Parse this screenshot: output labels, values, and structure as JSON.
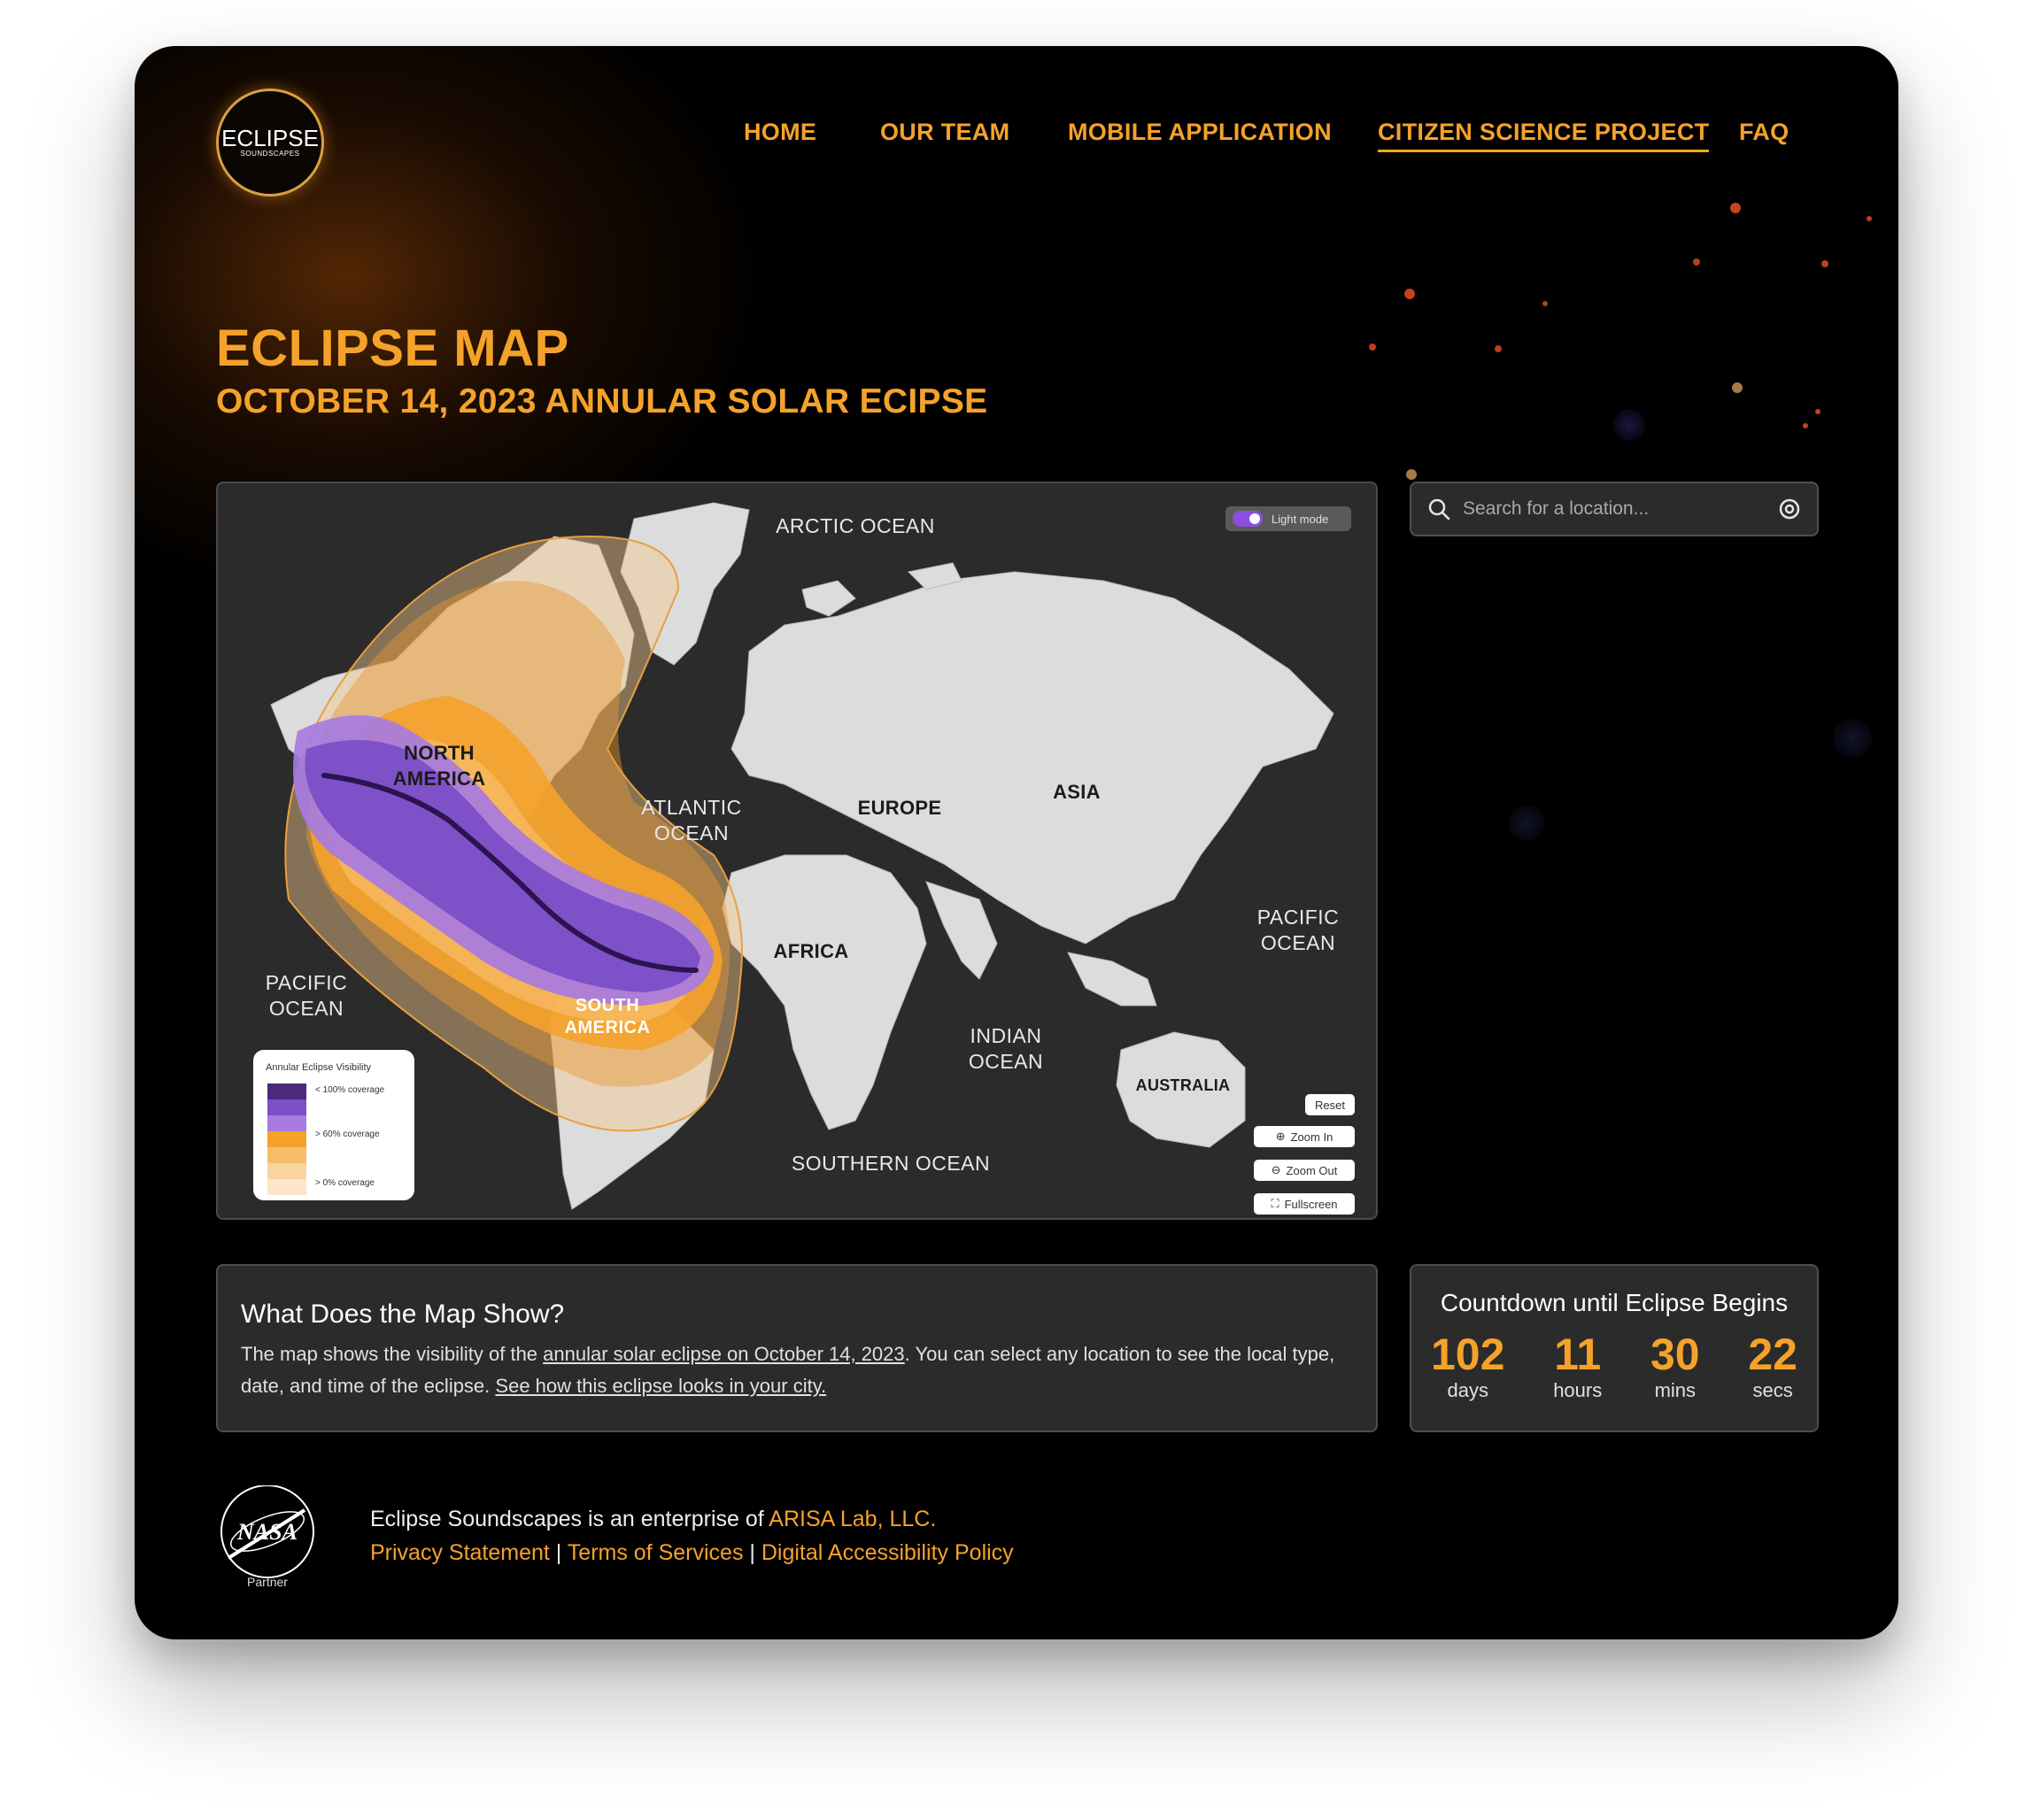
{
  "brand": {
    "logo_line1": "ECLIPSE",
    "logo_line2": "SOUNDSCAPES"
  },
  "nav": [
    {
      "label": "HOME",
      "active": false
    },
    {
      "label": "OUR TEAM",
      "active": false
    },
    {
      "label": "MOBILE APPLICATION",
      "active": false
    },
    {
      "label": "CITIZEN SCIENCE PROJECT",
      "active": true
    },
    {
      "label": "FAQ",
      "active": false
    }
  ],
  "page": {
    "title": "ECLIPSE MAP",
    "subtitle": "OCTOBER 14, 2023 ANNULAR SOLAR ECIPSE"
  },
  "map": {
    "toggle_label": "Light mode",
    "labels": {
      "arctic": "ARCTIC OCEAN",
      "north_america_1": "NORTH",
      "north_america_2": "AMERICA",
      "atlantic_1": "ATLANTIC",
      "atlantic_2": "OCEAN",
      "europe": "EUROPE",
      "asia": "ASIA",
      "africa": "AFRICA",
      "pacific_east_1": "PACIFIC",
      "pacific_east_2": "OCEAN",
      "pacific_west_1": "PACIFIC",
      "pacific_west_2": "OCEAN",
      "south_america_1": "SOUTH",
      "south_america_2": "AMERICA",
      "indian_1": "INDIAN",
      "indian_2": "OCEAN",
      "australia": "AUSTRALIA",
      "southern": "SOUTHERN OCEAN"
    },
    "legend": {
      "title": "Annular Eclipse Visibility",
      "items": [
        "< 100% coverage",
        "> 60% coverage",
        "> 0% coverage"
      ],
      "colors": [
        "#4a2a7a",
        "#7b4fc8",
        "#a77be0",
        "#f5a22a",
        "#f7bd6a",
        "#f9d3a0",
        "#fbe6c8"
      ]
    },
    "controls": {
      "reset": "Reset",
      "zoom_in": "Zoom In",
      "zoom_out": "Zoom Out",
      "fullscreen": "Fullscreen"
    }
  },
  "search": {
    "placeholder": "Search for a location..."
  },
  "info": {
    "heading": "What Does the Map Show?",
    "text_1": "The map shows the visibility of the ",
    "link_1": "annular solar eclipse on October 14, 2023",
    "text_2": ". You can select any location to see the local type, date, and time of the eclipse. ",
    "link_2": "See how this eclipse looks in your city."
  },
  "countdown": {
    "heading": "Countdown until Eclipse Begins",
    "days": "102",
    "days_label": "days",
    "hours": "11",
    "hours_label": "hours",
    "mins": "30",
    "mins_label": "mins",
    "secs": "22",
    "secs_label": "secs"
  },
  "footer": {
    "nasa_text": "NASA",
    "nasa_partner": "Partner",
    "line1_text": "Eclipse Soundscapes is an enterprise of ",
    "line1_link": "ARISA Lab, LLC.",
    "privacy": "Privacy Statement",
    "sep": " | ",
    "terms": "Terms of Services",
    "accessibility": "Digital Accessibility Policy"
  },
  "colors": {
    "accent": "#f5a22a",
    "background": "#000000",
    "card": "#2b2b2b",
    "umbra": "#7b4fc8"
  }
}
